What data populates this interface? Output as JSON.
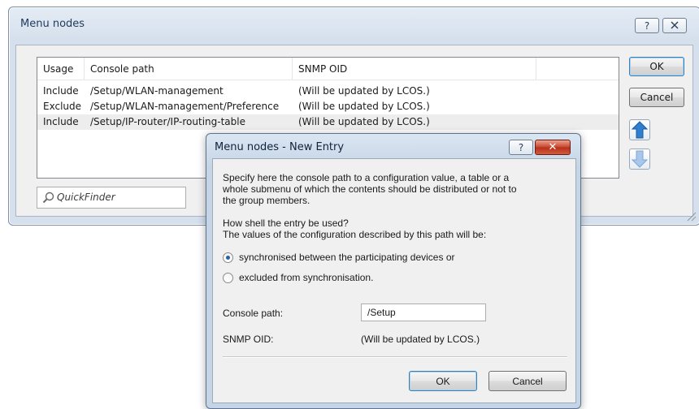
{
  "main_window": {
    "title": "Menu nodes",
    "help_button": "?",
    "close_button": "X",
    "ok_button": "OK",
    "cancel_button": "Cancel",
    "quickfinder_placeholder": "QuickFinder",
    "table": {
      "columns": [
        "Usage",
        "Console path",
        "SNMP OID"
      ],
      "rows": [
        {
          "usage": "Include",
          "path": "/Setup/WLAN-management",
          "oid": "(Will be updated by LCOS.)"
        },
        {
          "usage": "Exclude",
          "path": "/Setup/WLAN-management/Preference",
          "oid": "(Will be updated by LCOS.)"
        },
        {
          "usage": "Include",
          "path": "/Setup/IP-router/IP-routing-table",
          "oid": "(Will be updated by LCOS.)"
        }
      ]
    }
  },
  "dialog": {
    "title": "Menu nodes - New Entry",
    "help_button": "?",
    "close_button": "✕",
    "intro_line1": "Specify here the console path to a configuration value, a table or a",
    "intro_line2": "whole submenu of which the contents should be distributed or not to",
    "intro_line3": "the group members.",
    "question_line1": "How shell the entry be used?",
    "question_line2": "The values of the configuration described by this path will be:",
    "option_sync": "synchronised between the participating devices or",
    "option_exclude": "excluded from synchronisation.",
    "console_path_label": "Console path:",
    "console_path_value": "/Setup",
    "snmp_oid_label": "SNMP OID:",
    "snmp_oid_value": "(Will be updated by LCOS.)",
    "ok_button": "OK",
    "cancel_button": "Cancel"
  },
  "colors": {
    "selection_row": "#ededed",
    "arrow_up": "#2f7fd1",
    "arrow_down": "#a9c7ea",
    "close_red": "#c9452a"
  }
}
